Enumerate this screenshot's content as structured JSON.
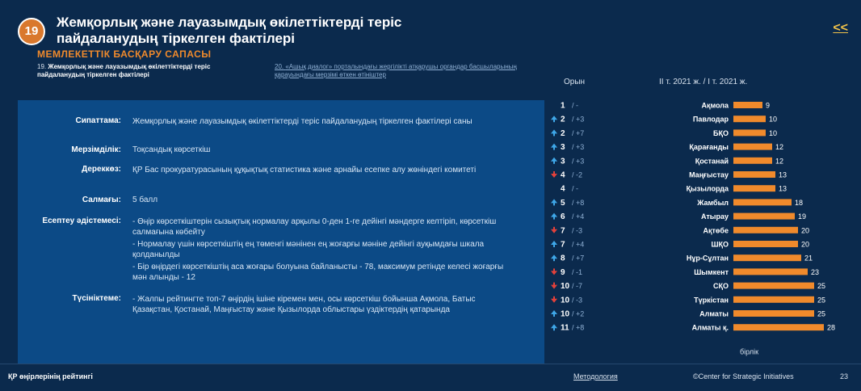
{
  "header": {
    "number": "19",
    "title_line1": "Жемқорлық және лауазымдық өкілеттіктерді теріс",
    "title_line2": "пайдаланудың тіркелген фактілері",
    "back_label": "<<"
  },
  "section": {
    "label": "МЕМЛЕКЕТТІК БАСҚАРУ САПАСЫ",
    "indicator_left_num": "19.",
    "indicator_left": "Жемқорлық және лауазымдық өкілеттіктерді теріс пайдаланудың тіркелген фактілері",
    "indicator_right_num": "20.",
    "indicator_right": "«Ашық диалог» порталындағы жергілікті атқарушы органдар басшыларының қарауындағы мерзімі өткен өтініштер"
  },
  "info": [
    {
      "key": "Сипаттама:",
      "value": "Жемқорлық және лауазымдық өкілеттіктерді теріс пайдаланудың тіркелген фактілері саны"
    },
    {
      "key": "Мерзімділік:",
      "value": "Тоқсандық көрсеткіш"
    },
    {
      "key": "Дереккөз:",
      "value": "ҚР Бас прокуратурасының құқықтық статистика және арнайы есепке алу жөніндегі комитеті"
    },
    {
      "key": "Салмағы:",
      "value": "5 балл"
    },
    {
      "key": "Есептеу әдістемесі:",
      "items": [
        "- Өңір көрсеткіштерін сызықтық нормалау арқылы 0-ден 1-ге дейінгі мәндерге келтіріп, көрсеткіш салмағына көбейту",
        "- Нормалау үшін көрсеткіштің ең төменгі мәнінен ең жоғарғы мәніне дейінгі ауқымдағы шкала қолданылды",
        "- Бір өңірдегі көрсеткіштің аса жоғары болуына байланысты - 78, максимум ретінде келесі жоғарғы мән алынды - 12"
      ]
    },
    {
      "key": "Түсініктеме:",
      "value": "- Жалпы рейтингте топ-7 өңірдің ішіне кіремен мен, осы көрсеткіш бойынша Ақмола, Батыс Қазақстан, Қостанай, Маңғыстау және Қызылорда облыстары үздіктердің қатарында"
    }
  ],
  "colors": {
    "background": "#0b2a4d",
    "panel": "#0c4a86",
    "accent": "#f08a2c",
    "up_arrow": "#3fa7e8",
    "down_arrow": "#e3413b"
  },
  "chart_data": {
    "type": "bar",
    "orientation": "horizontal",
    "rank_header": "Орын",
    "period_header": "II т. 2021 ж. / I т. 2021 ж.",
    "unit_label": "бірлік",
    "categories": [
      "Ақмола",
      "Павлодар",
      "БҚО",
      "Қарағанды",
      "Қостанай",
      "Маңғыстау",
      "Қызылорда",
      "Жамбыл",
      "Атырау",
      "Ақтөбе",
      "ШҚО",
      "Нұр-Сұлтан",
      "Шымкент",
      "СҚО",
      "Түркістан",
      "Алматы",
      "Алматы қ."
    ],
    "values": [
      9,
      10,
      10,
      12,
      12,
      13,
      13,
      18,
      19,
      20,
      20,
      21,
      23,
      25,
      25,
      25,
      28
    ],
    "ranks": [
      "1",
      "2",
      "2",
      "3",
      "3",
      "4",
      "4",
      "5",
      "6",
      "7",
      "7",
      "8",
      "9",
      "10",
      "10",
      "10",
      "11"
    ],
    "rank_changes": [
      "/ -",
      "/ +3",
      "/ +7",
      "/ +3",
      "/ +3",
      "/ -2",
      "/ -",
      "/ +8",
      "/ +4",
      "/ -3",
      "/ +4",
      "/ +7",
      "/ -1",
      "/ -7",
      "/ -3",
      "/ +2",
      "/ +8"
    ],
    "trend": [
      "none",
      "up",
      "up",
      "up",
      "up",
      "down",
      "none",
      "up",
      "up",
      "down",
      "up",
      "up",
      "down",
      "down",
      "down",
      "up",
      "up"
    ],
    "xlim": [
      0,
      30
    ]
  },
  "footer": {
    "left": "ҚР өңірлерінің рейтингі",
    "methodology": "Методология",
    "copyright": "©Center for Strategic Initiatives",
    "page": "23"
  }
}
